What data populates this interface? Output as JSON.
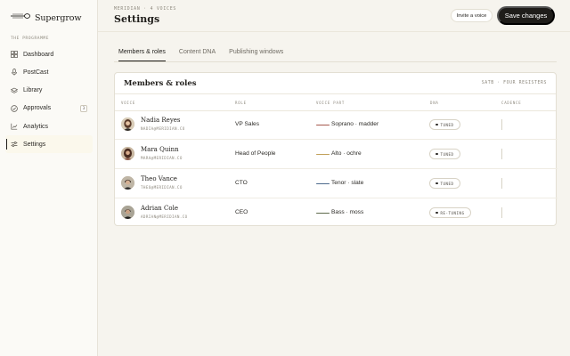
{
  "app": {
    "name": "Supergrow"
  },
  "sidebar": {
    "section_label": "THE PROGRAMME",
    "items": [
      {
        "label": "Dashboard",
        "icon": "grid-icon"
      },
      {
        "label": "PostCast",
        "icon": "microphone-icon"
      },
      {
        "label": "Library",
        "icon": "layers-icon"
      },
      {
        "label": "Approvals",
        "icon": "check-circle-icon",
        "count": "3"
      },
      {
        "label": "Analytics",
        "icon": "chart-icon"
      },
      {
        "label": "Settings",
        "icon": "sliders-icon",
        "active": true
      }
    ]
  },
  "header": {
    "eyebrow": "MERIDIAN · 4 VOICES",
    "title": "Settings",
    "invite_label": "Invite a voice",
    "save_label": "Save changes"
  },
  "tabs": [
    {
      "label": "Members & roles",
      "active": true
    },
    {
      "label": "Content DNA",
      "active": false
    },
    {
      "label": "Publishing windows",
      "active": false
    }
  ],
  "members": {
    "title": "Members & roles",
    "meta": "SATB · FOUR REGISTERS",
    "columns": [
      "VOICE",
      "ROLE",
      "VOICE PART",
      "DNA",
      "CADENCE"
    ],
    "rows": [
      {
        "name": "Nadia Reyes",
        "email": "NADIA@MERIDIAN.CO",
        "role": "VP Sales",
        "voice_part": "Soprano · madder",
        "part_color": "#a5574b",
        "dna": "TUNED"
      },
      {
        "name": "Mara Quinn",
        "email": "MARA@MERIDIAN.CO",
        "role": "Head of People",
        "voice_part": "Alto · ochre",
        "part_color": "#c2a15a",
        "dna": "TUNED"
      },
      {
        "name": "Theo Vance",
        "email": "THEO@MERIDIAN.CO",
        "role": "CTO",
        "voice_part": "Tenor · slate",
        "part_color": "#4d6a8c",
        "dna": "TUNED"
      },
      {
        "name": "Adrian Cole",
        "email": "ADRIAN@MERIDIAN.CO",
        "role": "CEO",
        "voice_part": "Bass · moss",
        "part_color": "#5f6a4c",
        "dna": "RE-TUNING"
      }
    ]
  }
}
